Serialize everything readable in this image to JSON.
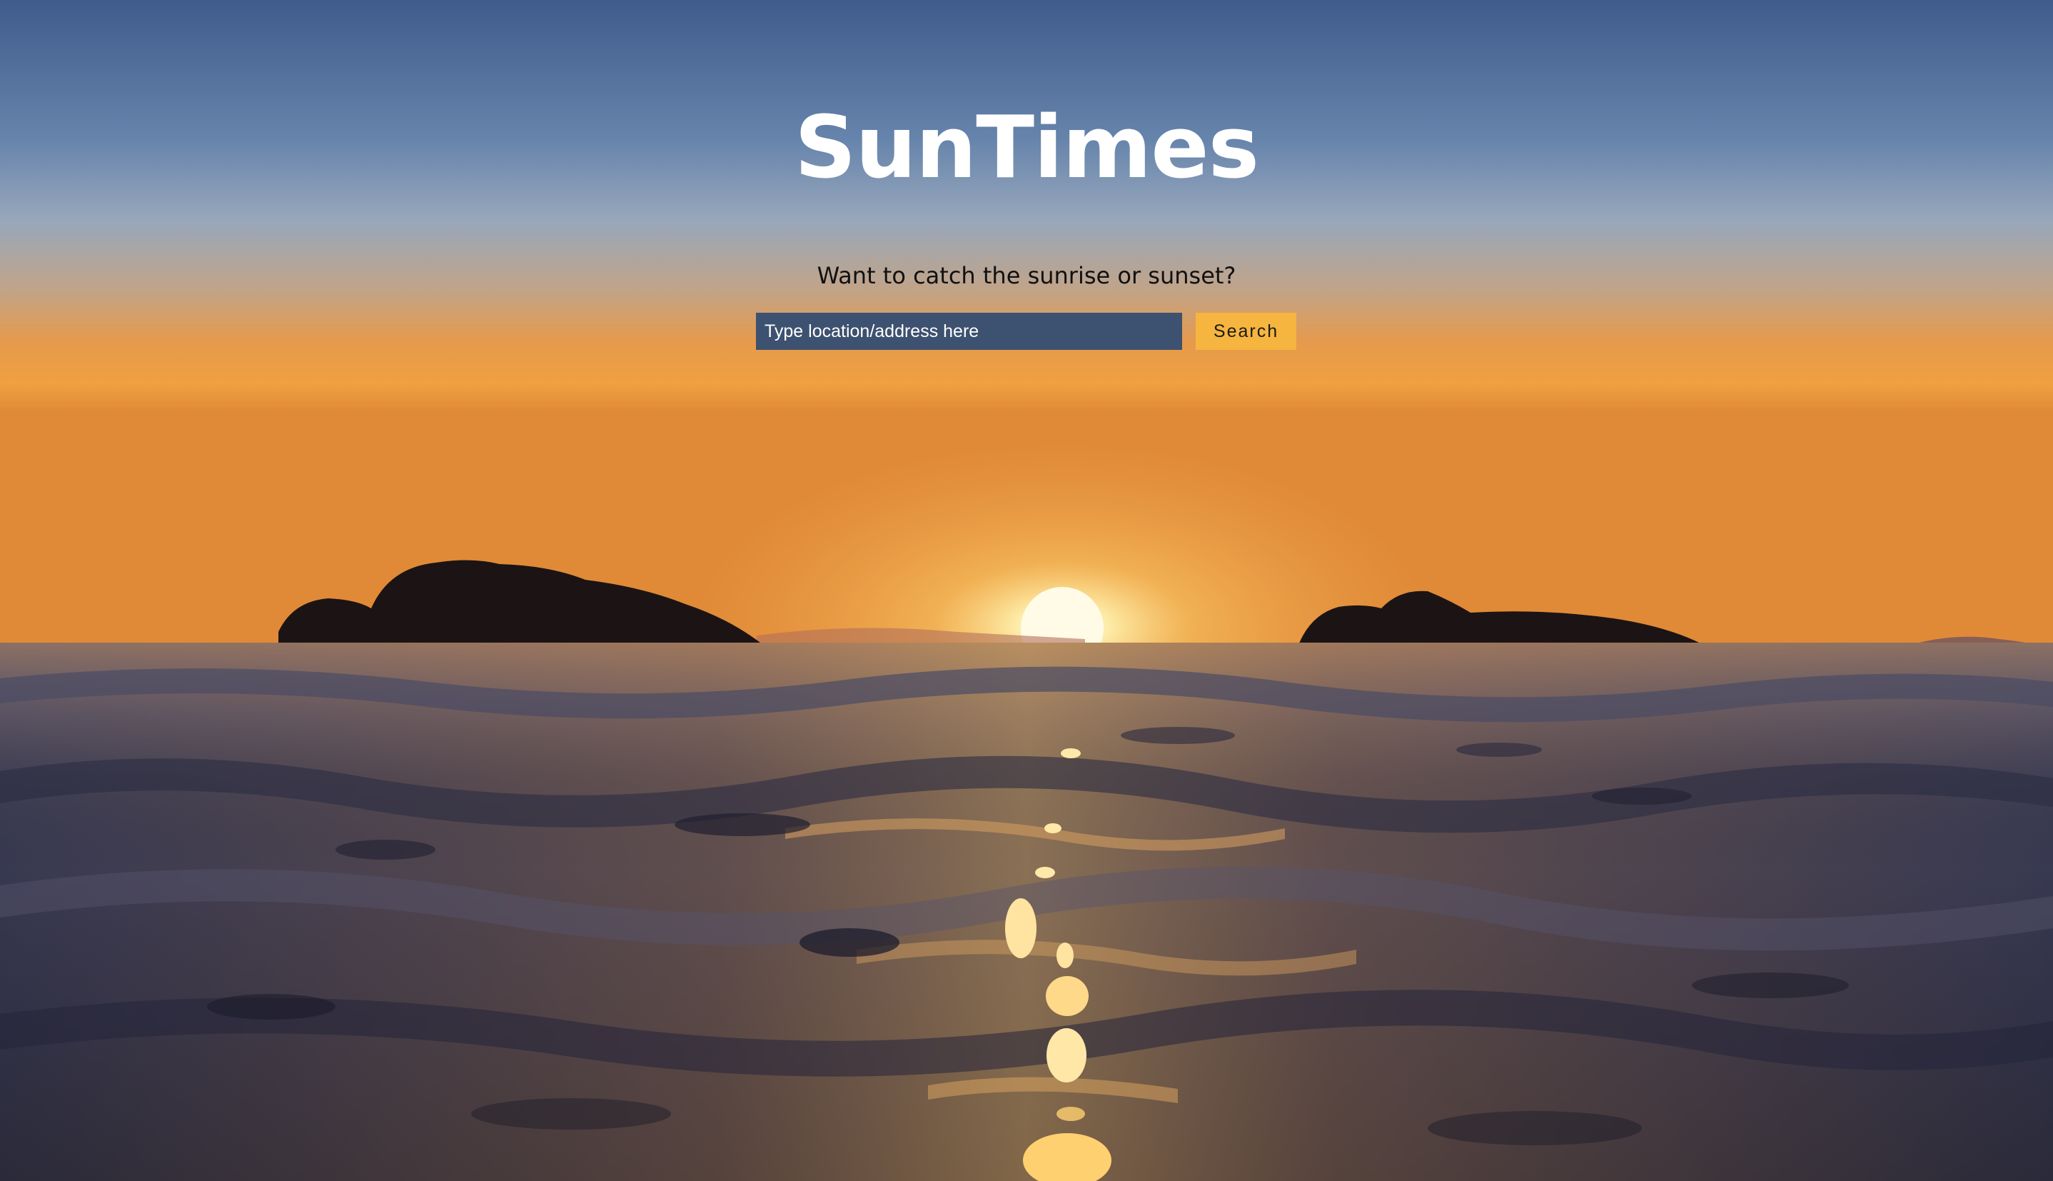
{
  "app": {
    "title": "SunTimes",
    "tagline": "Want to catch the sunrise or sunset?"
  },
  "search": {
    "placeholder": "Type location/address here",
    "value": "",
    "button_label": "Search"
  },
  "theme": {
    "accent": "#f6b53e",
    "input_background": "#3d5170",
    "title_color": "#ffffff"
  },
  "background": {
    "subject": "sunset-over-sea-photo"
  }
}
